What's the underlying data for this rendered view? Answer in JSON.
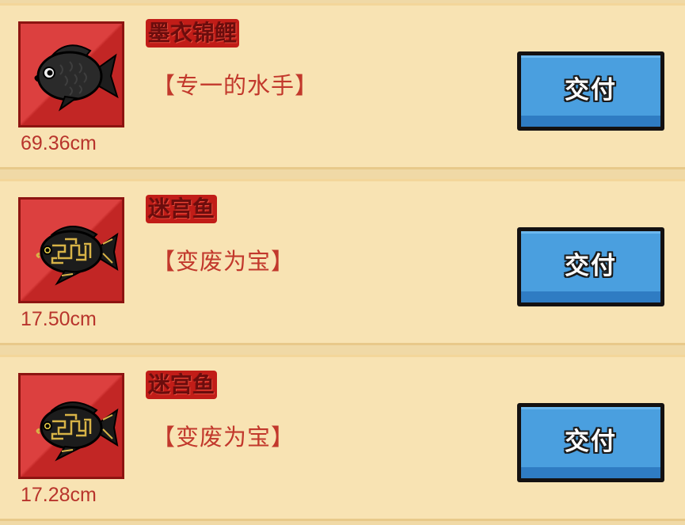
{
  "colors": {
    "background": "#f0d9a6",
    "row_bg": "#f8e3b3",
    "thumb_bg": "#d82a29",
    "name_bg": "#c11d18",
    "name_text": "#6b0d0d",
    "title_text": "#c2382c",
    "size_text": "#b8342c",
    "button_bg": "#4a9fdf"
  },
  "items": [
    {
      "name": "墨衣锦鲤",
      "title": "【专一的水手】",
      "size": "69.36cm",
      "icon": "black-carp-icon",
      "button_label": "交付"
    },
    {
      "name": "迷宫鱼",
      "title": "【变废为宝】",
      "size": "17.50cm",
      "icon": "maze-fish-icon",
      "button_label": "交付"
    },
    {
      "name": "迷宫鱼",
      "title": "【变废为宝】",
      "size": "17.28cm",
      "icon": "maze-fish-icon",
      "button_label": "交付"
    }
  ]
}
